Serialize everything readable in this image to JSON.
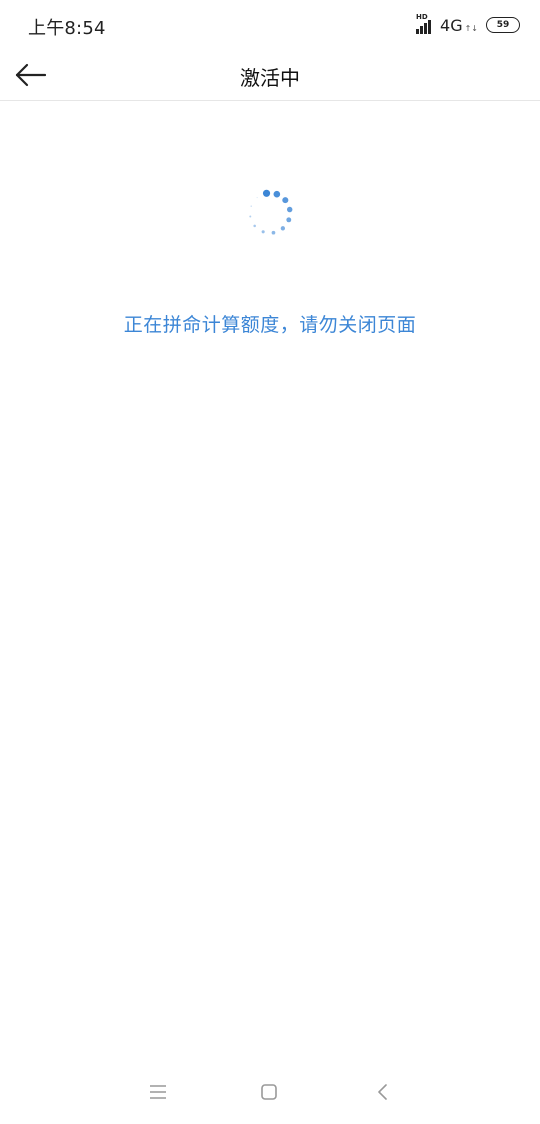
{
  "status_bar": {
    "time": "上午8:54",
    "hd_label": "HD",
    "network": "4G",
    "network_arrows": "↑↓",
    "battery_level": "59"
  },
  "header": {
    "title": "激活中",
    "back_icon": "arrow-left-icon"
  },
  "main": {
    "loading_message": "正在拼命计算额度，请勿关闭页面",
    "spinner_color": "#3c86d6"
  },
  "nav_bar": {
    "menu_icon": "menu-icon",
    "home_icon": "home-icon",
    "back_icon": "back-chevron-icon"
  },
  "colors": {
    "accent": "#3c86d6",
    "divider": "#e6e6e6"
  }
}
